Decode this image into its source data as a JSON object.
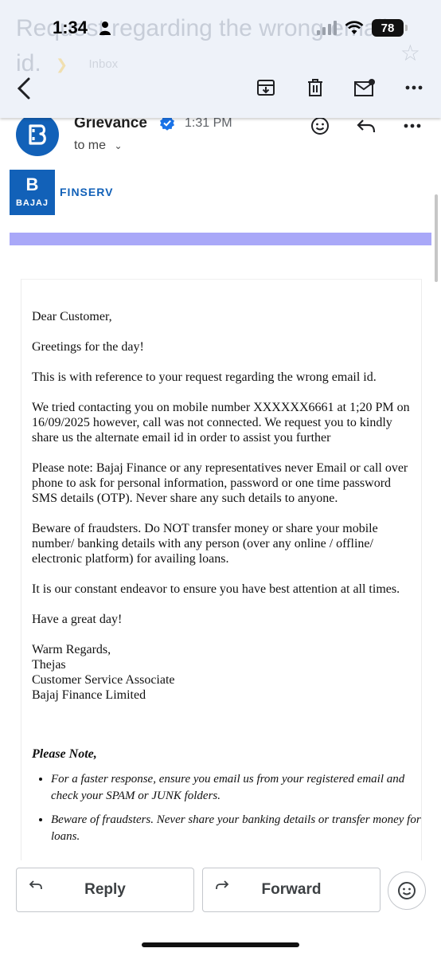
{
  "status_bar": {
    "time": "1:34",
    "battery": "78"
  },
  "header": {
    "subject_faded": "Request regarding the wrong email id.",
    "inbox_label": "Inbox"
  },
  "sender": {
    "name": "Grievance",
    "time": "1:31 PM",
    "recipient": "to me"
  },
  "brand": {
    "mark": "B",
    "word": "BAJAJ",
    "finserv": "FINSERV"
  },
  "email": {
    "greeting": "Dear Customer,",
    "para1": "Greetings for the day!",
    "para2": "This is with reference to your request regarding the wrong email id.",
    "para3": "We tried contacting you on mobile number XXXXXX6661 at 1;20 PM on 16/09/2025 however, call was not connected. We request you to kindly share us the alternate email id in order to assist you further",
    "para4": "Please note: Bajaj Finance or any representatives never Email or call over phone to ask for personal information, password or one time password SMS details (OTP). Never share any such details to anyone.",
    "para5": "Beware of fraudsters. Do NOT transfer money or share your mobile number/ banking details with any person (over any online / offline/ electronic platform) for availing loans.",
    "para6": "It is our constant endeavor to ensure you have best attention at all times.",
    "para7": "Have a great day!",
    "sign_off": "Warm Regards,",
    "signer": "Thejas",
    "signer_title": "Customer Service Associate",
    "company": "Bajaj Finance Limited",
    "note_title": "Please Note,",
    "notes": [
      "For a faster response, ensure you email us from your registered email and check your SPAM or JUNK folders.",
      "Beware of fraudsters. Never share your banking details or transfer money for loans."
    ]
  },
  "actions": {
    "reply_label": "Reply",
    "forward_label": "Forward"
  },
  "colors": {
    "brand_blue": "#1261b8",
    "band_purple": "#a9a8f8",
    "header_bg": "#eef2f9"
  },
  "icons": [
    "person-icon",
    "signal-icon",
    "wifi-icon",
    "battery-icon",
    "back-icon",
    "archive-icon",
    "delete-icon",
    "mark-unread-icon",
    "more-icon",
    "star-icon",
    "verified-icon",
    "chevron-down-icon",
    "emoji-icon",
    "reply-icon",
    "forward-icon"
  ]
}
